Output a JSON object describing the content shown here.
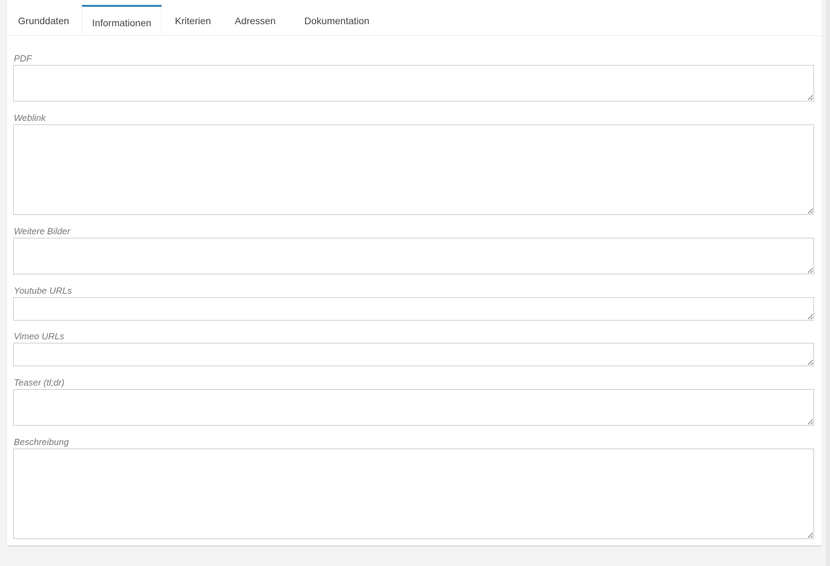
{
  "tabs": [
    {
      "label": "Grunddaten"
    },
    {
      "label": "Informationen",
      "active": true
    },
    {
      "label": "Kriterien"
    },
    {
      "label": "Adressen"
    },
    {
      "label": "Dokumentation"
    }
  ],
  "fields": {
    "pdf": {
      "label": "PDF",
      "value": ""
    },
    "weblink": {
      "label": "Weblink",
      "value": ""
    },
    "weitere_bilder": {
      "label": "Weitere Bilder",
      "value": ""
    },
    "youtube_urls": {
      "label": "Youtube URLs",
      "value": ""
    },
    "vimeo_urls": {
      "label": "Vimeo URLs",
      "value": ""
    },
    "teaser": {
      "label": "Teaser (tl;dr)",
      "value": ""
    },
    "beschreibung": {
      "label": "Beschreibung",
      "value": ""
    }
  },
  "colors": {
    "active_tab_accent": "#3c8dbc",
    "label_text": "#777777",
    "field_border": "#cfcfcf"
  }
}
